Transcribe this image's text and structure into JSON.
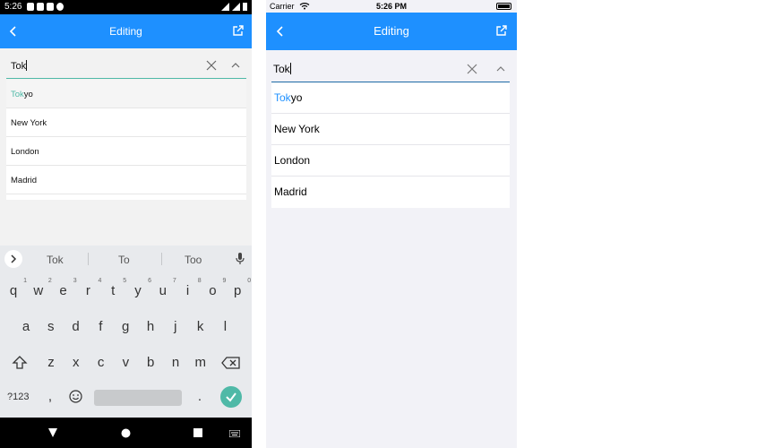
{
  "android": {
    "status": {
      "time": "5:26"
    },
    "appbar": {
      "title": "Editing"
    },
    "input": {
      "value": "Tok"
    },
    "suggestions": [
      {
        "match": "Tok",
        "rest": "yo"
      },
      {
        "match": "",
        "rest": "New York"
      },
      {
        "match": "",
        "rest": "London"
      },
      {
        "match": "",
        "rest": "Madrid"
      }
    ],
    "keyboard": {
      "word_suggestions": [
        "Tok",
        "To",
        "Too"
      ],
      "row1": [
        "q",
        "w",
        "e",
        "r",
        "t",
        "y",
        "u",
        "i",
        "o",
        "p"
      ],
      "row1_hints": [
        "1",
        "2",
        "3",
        "4",
        "5",
        "6",
        "7",
        "8",
        "9",
        "0"
      ],
      "row2": [
        "a",
        "s",
        "d",
        "f",
        "g",
        "h",
        "j",
        "k",
        "l"
      ],
      "row3": [
        "z",
        "x",
        "c",
        "v",
        "b",
        "n",
        "m"
      ],
      "symbols_key": "?123",
      "comma": ",",
      "period": "."
    }
  },
  "ios": {
    "status": {
      "carrier": "Carrier",
      "time": "5:26 PM"
    },
    "navbar": {
      "title": "Editing"
    },
    "input": {
      "value": "Tok"
    },
    "suggestions": [
      {
        "match": "Tok",
        "rest": "yo"
      },
      {
        "match": "",
        "rest": "New York"
      },
      {
        "match": "",
        "rest": "London"
      },
      {
        "match": "",
        "rest": "Madrid"
      }
    ]
  },
  "colors": {
    "navbar": "#1e90ff",
    "android_accent": "#4fb9a7",
    "ios_highlight": "#1e90ff"
  }
}
